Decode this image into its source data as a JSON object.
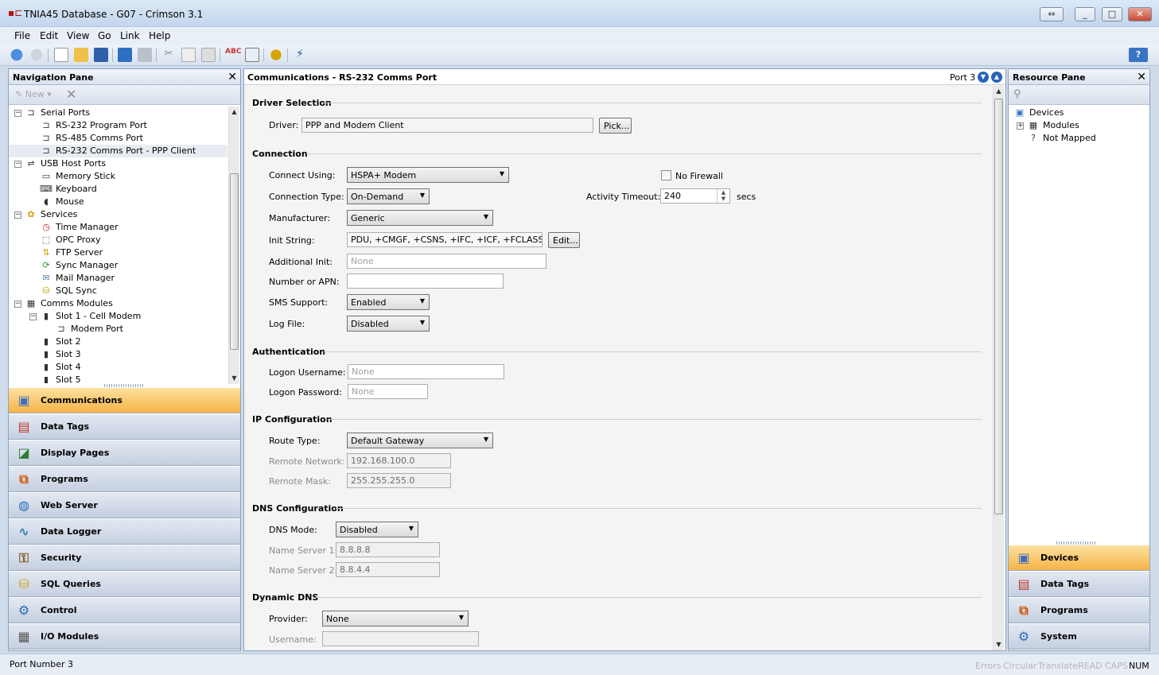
{
  "window": {
    "title": "TNIA45 Database - G07 - Crimson 3.1",
    "controls": [
      "⇔",
      "_",
      "□",
      "✕"
    ]
  },
  "menu": [
    "File",
    "Edit",
    "View",
    "Go",
    "Link",
    "Help"
  ],
  "toolbar": {
    "icons": [
      "back-icon",
      "forward-icon",
      "new-icon",
      "open-icon",
      "save-icon",
      "download-icon",
      "upload-icon",
      "cut-icon",
      "copy-icon",
      "paste-icon",
      "spellcheck-icon",
      "find-icon",
      "translate-icon",
      "link-icon"
    ],
    "help_glyph": "?"
  },
  "navigation_pane": {
    "title": "Navigation Pane",
    "new_label": "New",
    "tree": [
      {
        "label": "Serial Ports",
        "level": 1,
        "expander": "−",
        "icon": "serial-port-icon"
      },
      {
        "label": "RS-232 Program Port",
        "level": 2,
        "expander": "",
        "icon": "port-icon"
      },
      {
        "label": "RS-485 Comms Port",
        "level": 2,
        "expander": "",
        "icon": "port-icon"
      },
      {
        "label": "RS-232 Comms Port - PPP Client",
        "level": 2,
        "expander": "",
        "icon": "port-icon",
        "selected": true
      },
      {
        "label": "USB Host Ports",
        "level": 1,
        "expander": "−",
        "icon": "usb-icon"
      },
      {
        "label": "Memory Stick",
        "level": 2,
        "expander": "",
        "icon": "memory-stick-icon"
      },
      {
        "label": "Keyboard",
        "level": 2,
        "expander": "",
        "icon": "keyboard-icon"
      },
      {
        "label": "Mouse",
        "level": 2,
        "expander": "",
        "icon": "mouse-icon"
      },
      {
        "label": "Services",
        "level": 1,
        "expander": "−",
        "icon": "services-icon"
      },
      {
        "label": "Time Manager",
        "level": 2,
        "expander": "",
        "icon": "clock-icon"
      },
      {
        "label": "OPC Proxy",
        "level": 2,
        "expander": "",
        "icon": "opc-icon"
      },
      {
        "label": "FTP Server",
        "level": 2,
        "expander": "",
        "icon": "ftp-icon"
      },
      {
        "label": "Sync Manager",
        "level": 2,
        "expander": "",
        "icon": "sync-icon"
      },
      {
        "label": "Mail Manager",
        "level": 2,
        "expander": "",
        "icon": "mail-icon"
      },
      {
        "label": "SQL Sync",
        "level": 2,
        "expander": "",
        "icon": "sql-sync-icon"
      },
      {
        "label": "Comms Modules",
        "level": 1,
        "expander": "−",
        "icon": "modules-icon"
      },
      {
        "label": "Slot 1 - Cell Modem",
        "level": 2,
        "expander": "−",
        "icon": "slot-icon"
      },
      {
        "label": "Modem Port",
        "level": 3,
        "expander": "",
        "icon": "port-icon"
      },
      {
        "label": "Slot 2",
        "level": 2,
        "expander": "",
        "icon": "slot-icon"
      },
      {
        "label": "Slot 3",
        "level": 2,
        "expander": "",
        "icon": "slot-icon"
      },
      {
        "label": "Slot 4",
        "level": 2,
        "expander": "",
        "icon": "slot-icon"
      },
      {
        "label": "Slot 5",
        "level": 2,
        "expander": "",
        "icon": "slot-icon"
      }
    ],
    "categories": [
      {
        "label": "Communications",
        "icon": "communications-icon",
        "active": true
      },
      {
        "label": "Data Tags",
        "icon": "data-tags-icon"
      },
      {
        "label": "Display Pages",
        "icon": "display-pages-icon"
      },
      {
        "label": "Programs",
        "icon": "programs-icon"
      },
      {
        "label": "Web Server",
        "icon": "web-server-icon"
      },
      {
        "label": "Data Logger",
        "icon": "data-logger-icon"
      },
      {
        "label": "Security",
        "icon": "security-icon"
      },
      {
        "label": "SQL Queries",
        "icon": "sql-queries-icon"
      },
      {
        "label": "Control",
        "icon": "control-icon"
      },
      {
        "label": "I/O Modules",
        "icon": "io-modules-icon"
      }
    ]
  },
  "main": {
    "title": "Communications - RS-232 Comms Port",
    "port_label": "Port 3",
    "sections": {
      "driver": "Driver Selection",
      "connection": "Connection",
      "auth": "Authentication",
      "ip": "IP Configuration",
      "dns": "DNS Configuration",
      "ddns": "Dynamic DNS"
    },
    "driver": {
      "label": "Driver:",
      "value": "PPP and Modem Client",
      "pick": "Pick..."
    },
    "connection": {
      "connect_using_label": "Connect Using:",
      "connect_using": "HSPA+ Modem",
      "no_firewall_label": "No Firewall",
      "connection_type_label": "Connection Type:",
      "connection_type": "On-Demand",
      "activity_timeout_label": "Activity Timeout:",
      "activity_timeout": "240",
      "timeout_unit": "secs",
      "manufacturer_label": "Manufacturer:",
      "manufacturer": "Generic",
      "init_string_label": "Init String:",
      "init_string": "PDU, +CMGF, +CSNS, +IFC, +ICF, +FCLASS, +C",
      "edit": "Edit...",
      "additional_init_label": "Additional Init:",
      "additional_init_placeholder": "None",
      "number_apn_label": "Number or APN:",
      "number_apn": "",
      "sms_support_label": "SMS Support:",
      "sms_support": "Enabled",
      "log_file_label": "Log File:",
      "log_file": "Disabled"
    },
    "auth": {
      "username_label": "Logon Username:",
      "username_placeholder": "None",
      "password_label": "Logon Password:",
      "password_placeholder": "None"
    },
    "ip": {
      "route_type_label": "Route Type:",
      "route_type": "Default Gateway",
      "remote_network_label": "Remote Network:",
      "remote_network": "192.168.100.0",
      "remote_mask_label": "Remote Mask:",
      "remote_mask": "255.255.255.0"
    },
    "dns": {
      "mode_label": "DNS Mode:",
      "mode": "Disabled",
      "ns1_label": "Name Server 1:",
      "ns1": "8.8.8.8",
      "ns2_label": "Name Server 2:",
      "ns2": "8.8.4.4"
    },
    "ddns": {
      "provider_label": "Provider:",
      "provider": "None",
      "username_label": "Username:",
      "username": ""
    }
  },
  "resource_pane": {
    "title": "Resource Pane",
    "tree": [
      {
        "label": "Devices",
        "icon": "devices-icon"
      },
      {
        "label": "Modules",
        "icon": "modules-icon",
        "expander": "+"
      },
      {
        "label": "Not Mapped",
        "icon": "unknown-icon"
      }
    ],
    "categories": [
      {
        "label": "Devices",
        "icon": "devices-icon",
        "active": true
      },
      {
        "label": "Data Tags",
        "icon": "data-tags-icon"
      },
      {
        "label": "Programs",
        "icon": "programs-icon"
      },
      {
        "label": "System",
        "icon": "system-icon"
      }
    ]
  },
  "status": {
    "text": "Port Number 3",
    "indicators": [
      "Errors",
      "Circular",
      "Translate",
      "READ",
      "CAPS",
      "NUM"
    ],
    "active_indicator": "NUM"
  },
  "colors": {
    "accent": "#f6b347",
    "title_bg": "#cfdbea"
  }
}
